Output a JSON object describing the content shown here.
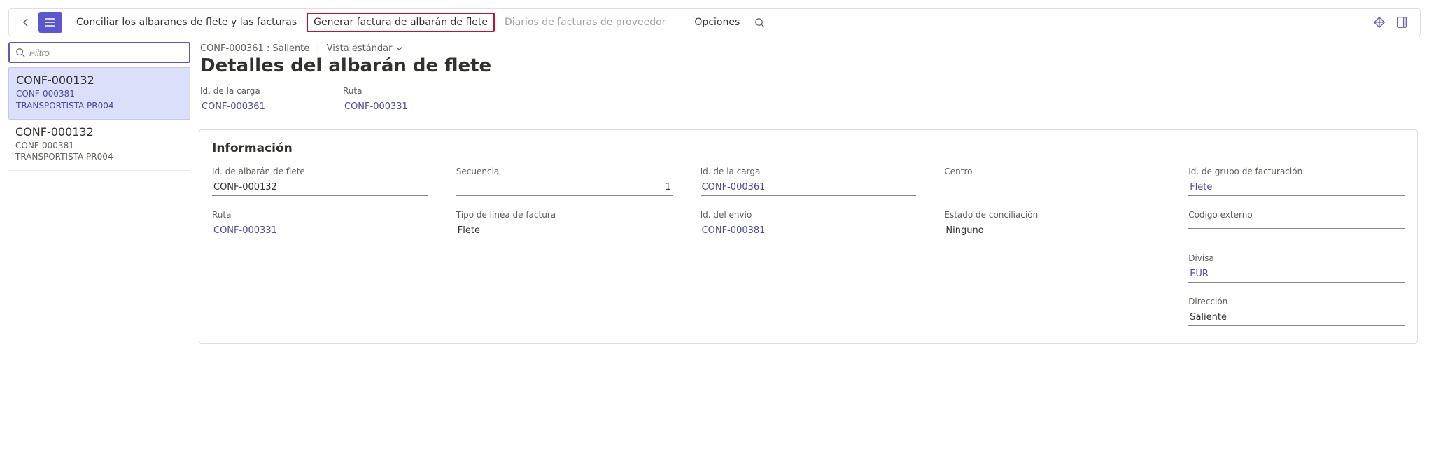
{
  "appbar": {
    "commands": {
      "reconcile": "Conciliar los albaranes de flete y las facturas",
      "generate": "Generar factura de albarán de flete",
      "journals": "Diarios de facturas de proveedor",
      "options": "Opciones"
    }
  },
  "sidebar": {
    "filter_placeholder": "Filtro",
    "items": [
      {
        "title": "CONF-000132",
        "sub1": "CONF-000381",
        "sub2": "TRANSPORTISTA PR004"
      },
      {
        "title": "CONF-000132",
        "sub1": "CONF-000381",
        "sub2": "TRANSPORTISTA PR004"
      }
    ]
  },
  "breadcrumb": {
    "id": "CONF-000361",
    "direction": "Saliente",
    "view": "Vista estándar"
  },
  "page_title": "Detalles del albarán de flete",
  "top_fields": {
    "load_id_label": "Id. de la carga",
    "load_id": "CONF-000361",
    "route_label": "Ruta",
    "route": "CONF-000331"
  },
  "info": {
    "section_title": "Información",
    "rows": {
      "freight_bill_id_label": "Id. de albarán de flete",
      "freight_bill_id": "CONF-000132",
      "sequence_label": "Secuencia",
      "sequence": "1",
      "load_id_label": "Id. de la carga",
      "load_id": "CONF-000361",
      "center_label": "Centro",
      "center": "",
      "billing_group_label": "Id. de grupo de facturación",
      "billing_group": "Flete",
      "route_label": "Ruta",
      "route": "CONF-000331",
      "line_type_label": "Tipo de línea de factura",
      "line_type": "Flete",
      "ship_id_label": "Id. del envío",
      "ship_id": "CONF-000381",
      "recon_label": "Estado de conciliación",
      "recon": "Ninguno",
      "ext_code_label": "Código externo",
      "ext_code": "",
      "currency_label": "Divisa",
      "currency": "EUR",
      "direction_label": "Dirección",
      "direction": "Saliente"
    }
  }
}
